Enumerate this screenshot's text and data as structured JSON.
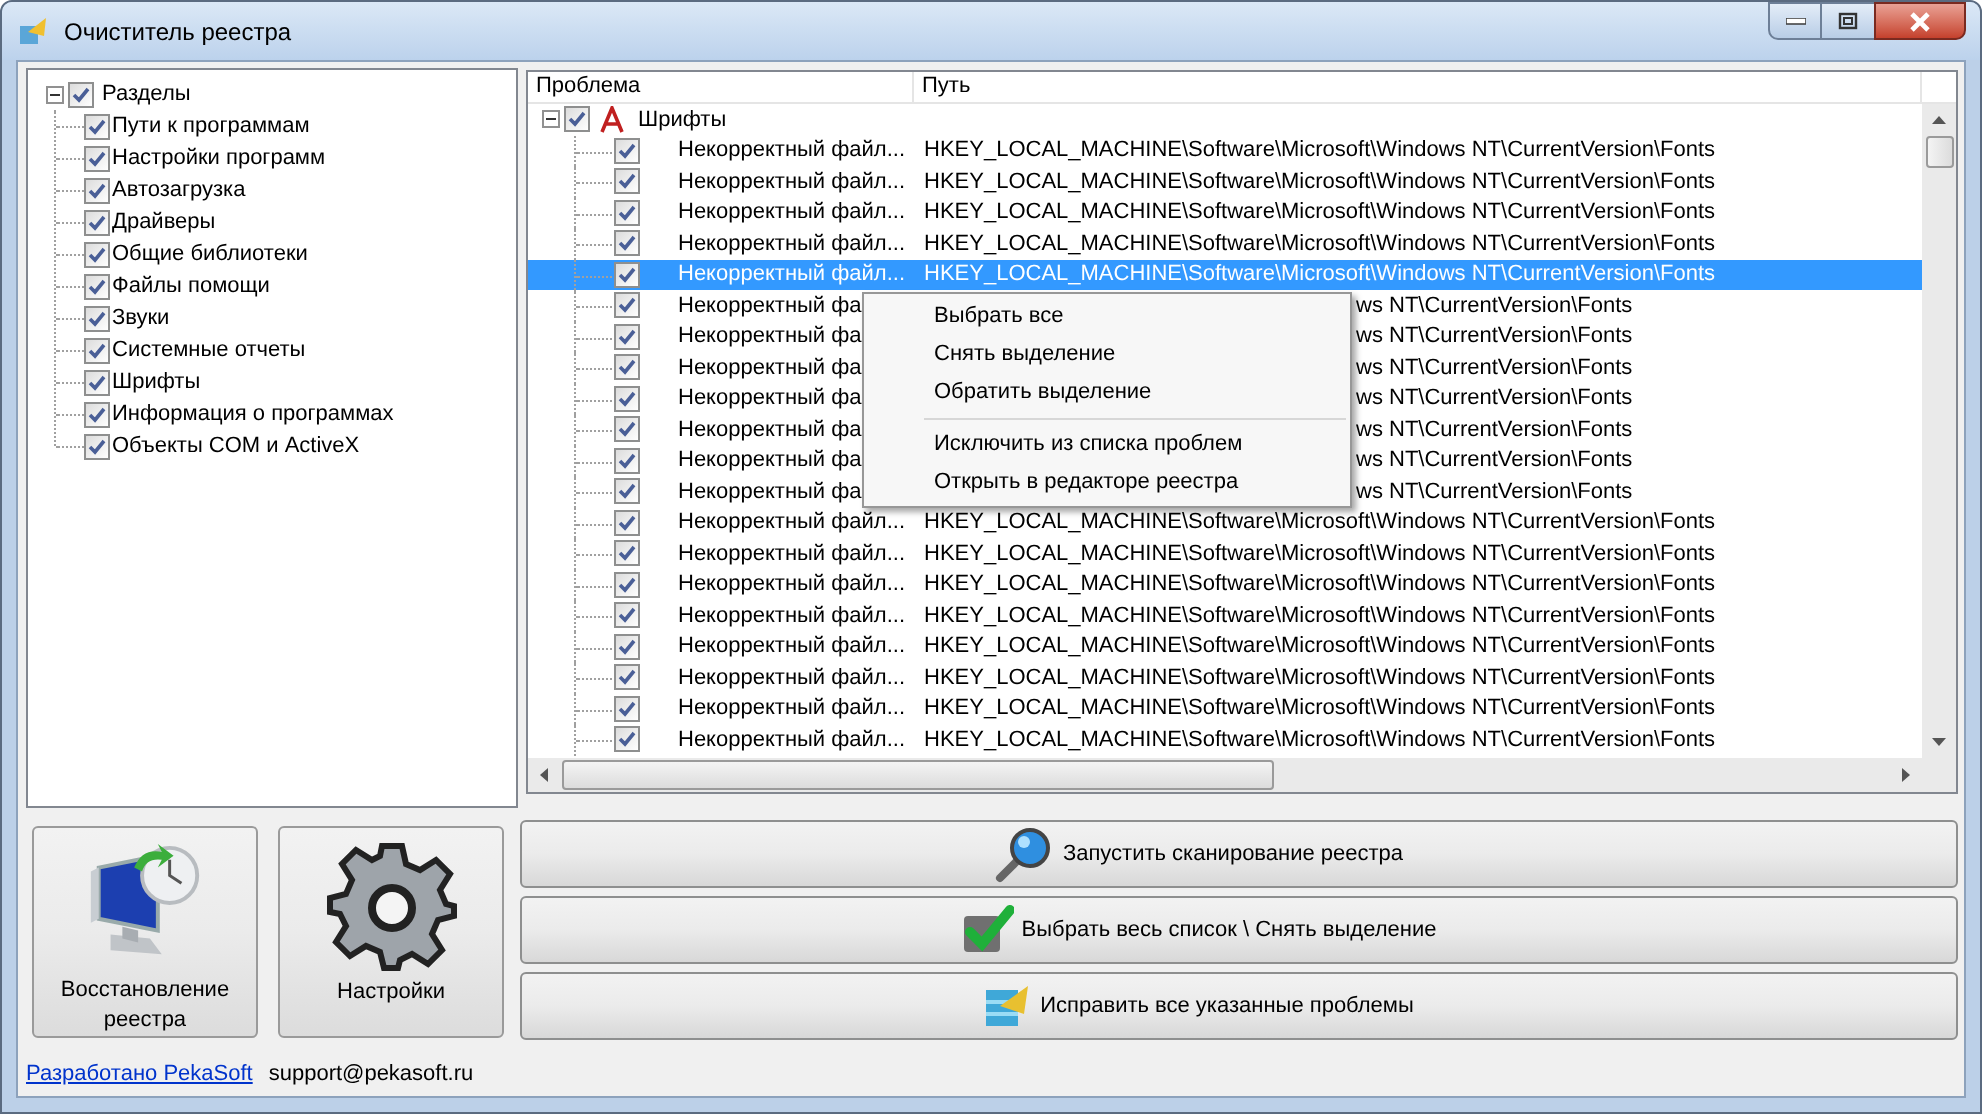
{
  "window": {
    "title": "Очиститель реестра"
  },
  "sections": {
    "label": "Разделы",
    "checked": true,
    "expanded": true,
    "children": [
      {
        "label": "Пути к программам",
        "checked": true
      },
      {
        "label": "Настройки программ",
        "checked": true
      },
      {
        "label": "Автозагрузка",
        "checked": true
      },
      {
        "label": "Драйверы",
        "checked": true
      },
      {
        "label": "Общие библиотеки",
        "checked": true
      },
      {
        "label": "Файлы помощи",
        "checked": true
      },
      {
        "label": "Звуки",
        "checked": true
      },
      {
        "label": "Системные отчеты",
        "checked": true
      },
      {
        "label": "Шрифты",
        "checked": true
      },
      {
        "label": "Информация о программах",
        "checked": true
      },
      {
        "label": "Объекты COM и ActiveX",
        "checked": true
      }
    ]
  },
  "problems": {
    "columns": [
      "Проблема",
      "Путь"
    ],
    "groups": [
      {
        "label": "Шрифты",
        "checked": true,
        "expanded": true,
        "rows": [
          {
            "kind": "row",
            "problem": "Некорректный файл...",
            "path": "HKEY_LOCAL_MACHINE\\Software\\Microsoft\\Windows NT\\CurrentVersion\\Fonts",
            "checked": true,
            "selected": false
          },
          {
            "kind": "row",
            "problem": "Некорректный файл...",
            "path": "HKEY_LOCAL_MACHINE\\Software\\Microsoft\\Windows NT\\CurrentVersion\\Fonts",
            "checked": true,
            "selected": false
          },
          {
            "kind": "row",
            "problem": "Некорректный файл...",
            "path": "HKEY_LOCAL_MACHINE\\Software\\Microsoft\\Windows NT\\CurrentVersion\\Fonts",
            "checked": true,
            "selected": false
          },
          {
            "kind": "row",
            "problem": "Некорректный файл...",
            "path": "HKEY_LOCAL_MACHINE\\Software\\Microsoft\\Windows NT\\CurrentVersion\\Fonts",
            "checked": true,
            "selected": false
          },
          {
            "kind": "row",
            "problem": "Некорректный файл...",
            "path": "HKEY_LOCAL_MACHINE\\Software\\Microsoft\\Windows NT\\CurrentVersion\\Fonts",
            "checked": true,
            "selected": true
          },
          {
            "kind": "covered",
            "problem": "Некорректный фа",
            "path": "ws NT\\CurrentVersion\\Fonts",
            "checked": true,
            "selected": false
          },
          {
            "kind": "covered",
            "problem": "Некорректный фа",
            "path": "ws NT\\CurrentVersion\\Fonts",
            "checked": true,
            "selected": false
          },
          {
            "kind": "covered",
            "problem": "Некорректный фа",
            "path": "ws NT\\CurrentVersion\\Fonts",
            "checked": true,
            "selected": false
          },
          {
            "kind": "covered",
            "problem": "Некорректный фа",
            "path": "ws NT\\CurrentVersion\\Fonts",
            "checked": true,
            "selected": false
          },
          {
            "kind": "covered",
            "problem": "Некорректный фа",
            "path": "ws NT\\CurrentVersion\\Fonts",
            "checked": true,
            "selected": false
          },
          {
            "kind": "covered",
            "problem": "Некорректный фа",
            "path": "ws NT\\CurrentVersion\\Fonts",
            "checked": true,
            "selected": false
          },
          {
            "kind": "covered",
            "problem": "Некорректный фа",
            "path": "ws NT\\CurrentVersion\\Fonts",
            "checked": true,
            "selected": false
          },
          {
            "kind": "row",
            "problem": "Некорректный файл...",
            "path": "HKEY_LOCAL_MACHINE\\Software\\Microsoft\\Windows NT\\CurrentVersion\\Fonts",
            "checked": true,
            "selected": false
          },
          {
            "kind": "row",
            "problem": "Некорректный файл...",
            "path": "HKEY_LOCAL_MACHINE\\Software\\Microsoft\\Windows NT\\CurrentVersion\\Fonts",
            "checked": true,
            "selected": false
          },
          {
            "kind": "row",
            "problem": "Некорректный файл...",
            "path": "HKEY_LOCAL_MACHINE\\Software\\Microsoft\\Windows NT\\CurrentVersion\\Fonts",
            "checked": true,
            "selected": false
          },
          {
            "kind": "row",
            "problem": "Некорректный файл...",
            "path": "HKEY_LOCAL_MACHINE\\Software\\Microsoft\\Windows NT\\CurrentVersion\\Fonts",
            "checked": true,
            "selected": false
          },
          {
            "kind": "row",
            "problem": "Некорректный файл...",
            "path": "HKEY_LOCAL_MACHINE\\Software\\Microsoft\\Windows NT\\CurrentVersion\\Fonts",
            "checked": true,
            "selected": false
          },
          {
            "kind": "row",
            "problem": "Некорректный файл...",
            "path": "HKEY_LOCAL_MACHINE\\Software\\Microsoft\\Windows NT\\CurrentVersion\\Fonts",
            "checked": true,
            "selected": false
          },
          {
            "kind": "row",
            "problem": "Некорректный файл...",
            "path": "HKEY_LOCAL_MACHINE\\Software\\Microsoft\\Windows NT\\CurrentVersion\\Fonts",
            "checked": true,
            "selected": false
          },
          {
            "kind": "row",
            "problem": "Некорректный файл...",
            "path": "HKEY_LOCAL_MACHINE\\Software\\Microsoft\\Windows NT\\CurrentVersion\\Fonts",
            "checked": true,
            "selected": false
          }
        ]
      }
    ]
  },
  "context_menu": {
    "items": [
      {
        "kind": "item",
        "label": "Выбрать все"
      },
      {
        "kind": "item",
        "label": "Снять выделение"
      },
      {
        "kind": "item",
        "label": "Обратить выделение"
      },
      {
        "kind": "separator"
      },
      {
        "kind": "item",
        "label": "Исключить из списка проблем"
      },
      {
        "kind": "item",
        "label": "Открыть в редакторе реестра"
      }
    ]
  },
  "tool_buttons": [
    {
      "kind": "restore",
      "label": "Восстановление реестра"
    },
    {
      "kind": "settings",
      "label": "Настройки"
    }
  ],
  "action_buttons": [
    {
      "kind": "scan",
      "label": "Запустить сканирование реестра"
    },
    {
      "kind": "select",
      "label": "Выбрать весь список \\ Снять выделение"
    },
    {
      "kind": "fix",
      "label": "Исправить все указанные проблемы"
    }
  ],
  "status_bar": {
    "link": "Разработано PekaSoft",
    "email": "support@pekasoft.ru"
  }
}
